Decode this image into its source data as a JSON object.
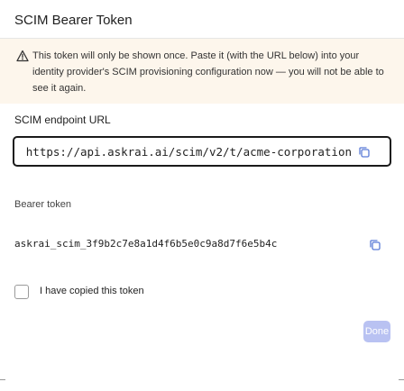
{
  "dialog": {
    "title": "SCIM Bearer Token"
  },
  "warning": {
    "icon": "warning-triangle-icon",
    "text": "This token will only be shown once. Paste it (with the URL below) into your identity provider's SCIM provisioning configuration now — you will not be able to see it again."
  },
  "endpoint": {
    "label": "SCIM endpoint URL",
    "value": "https://api.askrai.ai/scim/v2/t/acme-corporation",
    "copy_icon": "copy-icon"
  },
  "token": {
    "label": "Bearer token",
    "value": "askrai_scim_3f9b2c7e8a1d4f6b5e0c9a8d7f6e5b4c",
    "copy_icon": "copy-icon"
  },
  "confirm": {
    "label": "I have copied this token",
    "checked": false
  },
  "actions": {
    "done_label": "Done"
  },
  "colors": {
    "warning_bg": "#fdf6ec",
    "primary_disabled": "#b9c2f2"
  }
}
